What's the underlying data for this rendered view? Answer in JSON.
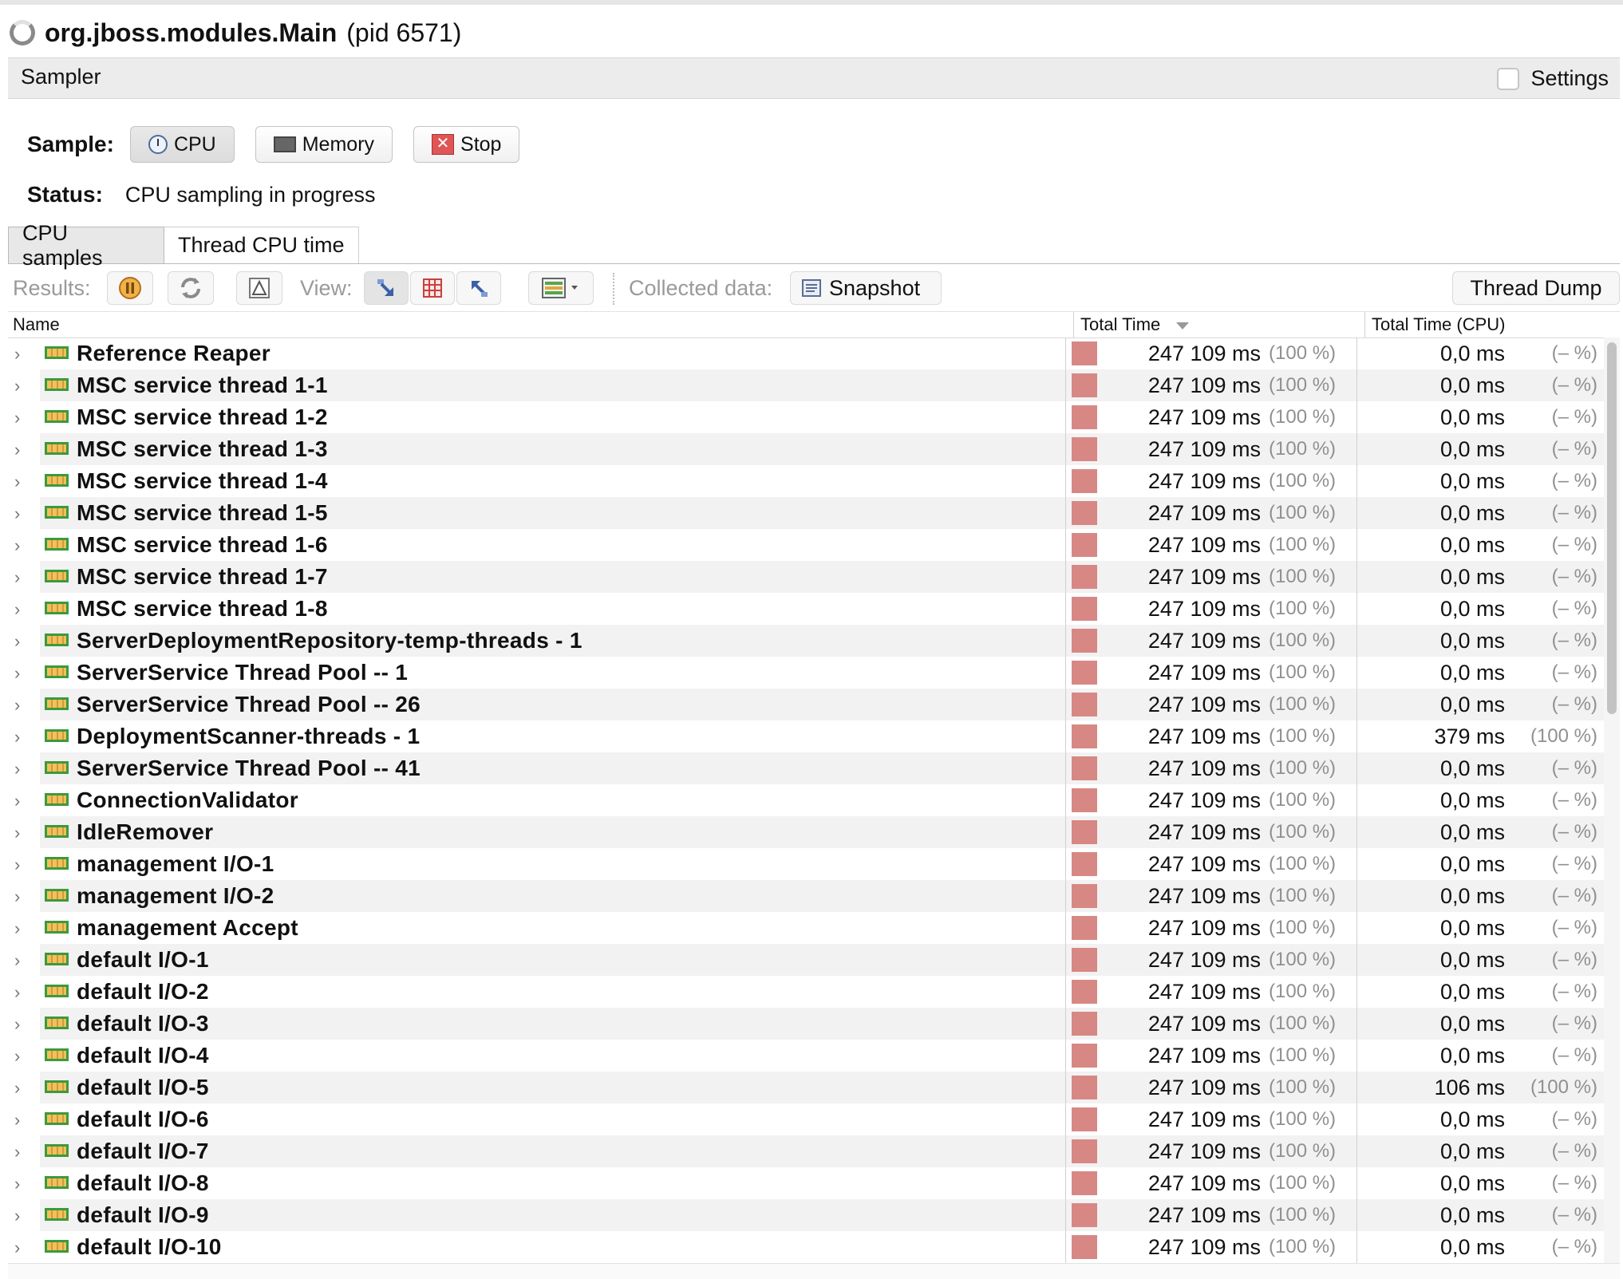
{
  "window": {
    "title": "org.jboss.modules.Main",
    "pid": "(pid 6571)"
  },
  "sampler": {
    "label": "Sampler",
    "settings_label": "Settings"
  },
  "sample": {
    "label": "Sample:",
    "cpu_label": "CPU",
    "memory_label": "Memory",
    "stop_label": "Stop",
    "status_label": "Status:",
    "status_value": "CPU sampling in progress"
  },
  "tabs": [
    {
      "label": "CPU samples",
      "active": true
    },
    {
      "label": "Thread CPU time",
      "active": false
    }
  ],
  "toolbar": {
    "results_label": "Results:",
    "view_label": "View:",
    "collected_label": "Collected data:",
    "snapshot_label": "Snapshot",
    "thread_dump_label": "Thread Dump"
  },
  "table": {
    "columns": {
      "name": "Name",
      "total_time": "Total Time",
      "total_time_cpu": "Total Time (CPU)"
    },
    "rows": [
      {
        "name": "Reference Reaper",
        "total": "247 109 ms",
        "total_pct": "(100 %)",
        "cpu": "0,0 ms",
        "cpu_pct": "(– %)"
      },
      {
        "name": "MSC service thread 1-1",
        "total": "247 109 ms",
        "total_pct": "(100 %)",
        "cpu": "0,0 ms",
        "cpu_pct": "(– %)"
      },
      {
        "name": "MSC service thread 1-2",
        "total": "247 109 ms",
        "total_pct": "(100 %)",
        "cpu": "0,0 ms",
        "cpu_pct": "(– %)"
      },
      {
        "name": "MSC service thread 1-3",
        "total": "247 109 ms",
        "total_pct": "(100 %)",
        "cpu": "0,0 ms",
        "cpu_pct": "(– %)"
      },
      {
        "name": "MSC service thread 1-4",
        "total": "247 109 ms",
        "total_pct": "(100 %)",
        "cpu": "0,0 ms",
        "cpu_pct": "(– %)"
      },
      {
        "name": "MSC service thread 1-5",
        "total": "247 109 ms",
        "total_pct": "(100 %)",
        "cpu": "0,0 ms",
        "cpu_pct": "(– %)"
      },
      {
        "name": "MSC service thread 1-6",
        "total": "247 109 ms",
        "total_pct": "(100 %)",
        "cpu": "0,0 ms",
        "cpu_pct": "(– %)"
      },
      {
        "name": "MSC service thread 1-7",
        "total": "247 109 ms",
        "total_pct": "(100 %)",
        "cpu": "0,0 ms",
        "cpu_pct": "(– %)"
      },
      {
        "name": "MSC service thread 1-8",
        "total": "247 109 ms",
        "total_pct": "(100 %)",
        "cpu": "0,0 ms",
        "cpu_pct": "(– %)"
      },
      {
        "name": "ServerDeploymentRepository-temp-threads - 1",
        "total": "247 109 ms",
        "total_pct": "(100 %)",
        "cpu": "0,0 ms",
        "cpu_pct": "(– %)"
      },
      {
        "name": "ServerService Thread Pool -- 1",
        "total": "247 109 ms",
        "total_pct": "(100 %)",
        "cpu": "0,0 ms",
        "cpu_pct": "(– %)"
      },
      {
        "name": "ServerService Thread Pool -- 26",
        "total": "247 109 ms",
        "total_pct": "(100 %)",
        "cpu": "0,0 ms",
        "cpu_pct": "(– %)"
      },
      {
        "name": "DeploymentScanner-threads - 1",
        "total": "247 109 ms",
        "total_pct": "(100 %)",
        "cpu": "379 ms",
        "cpu_pct": "(100 %)"
      },
      {
        "name": "ServerService Thread Pool -- 41",
        "total": "247 109 ms",
        "total_pct": "(100 %)",
        "cpu": "0,0 ms",
        "cpu_pct": "(– %)"
      },
      {
        "name": "ConnectionValidator",
        "total": "247 109 ms",
        "total_pct": "(100 %)",
        "cpu": "0,0 ms",
        "cpu_pct": "(– %)"
      },
      {
        "name": "IdleRemover",
        "total": "247 109 ms",
        "total_pct": "(100 %)",
        "cpu": "0,0 ms",
        "cpu_pct": "(– %)"
      },
      {
        "name": "management I/O-1",
        "total": "247 109 ms",
        "total_pct": "(100 %)",
        "cpu": "0,0 ms",
        "cpu_pct": "(– %)"
      },
      {
        "name": "management I/O-2",
        "total": "247 109 ms",
        "total_pct": "(100 %)",
        "cpu": "0,0 ms",
        "cpu_pct": "(– %)"
      },
      {
        "name": "management Accept",
        "total": "247 109 ms",
        "total_pct": "(100 %)",
        "cpu": "0,0 ms",
        "cpu_pct": "(– %)"
      },
      {
        "name": "default I/O-1",
        "total": "247 109 ms",
        "total_pct": "(100 %)",
        "cpu": "0,0 ms",
        "cpu_pct": "(– %)"
      },
      {
        "name": "default I/O-2",
        "total": "247 109 ms",
        "total_pct": "(100 %)",
        "cpu": "0,0 ms",
        "cpu_pct": "(– %)"
      },
      {
        "name": "default I/O-3",
        "total": "247 109 ms",
        "total_pct": "(100 %)",
        "cpu": "0,0 ms",
        "cpu_pct": "(– %)"
      },
      {
        "name": "default I/O-4",
        "total": "247 109 ms",
        "total_pct": "(100 %)",
        "cpu": "0,0 ms",
        "cpu_pct": "(– %)"
      },
      {
        "name": "default I/O-5",
        "total": "247 109 ms",
        "total_pct": "(100 %)",
        "cpu": "106 ms",
        "cpu_pct": "(100 %)"
      },
      {
        "name": "default I/O-6",
        "total": "247 109 ms",
        "total_pct": "(100 %)",
        "cpu": "0,0 ms",
        "cpu_pct": "(– %)"
      },
      {
        "name": "default I/O-7",
        "total": "247 109 ms",
        "total_pct": "(100 %)",
        "cpu": "0,0 ms",
        "cpu_pct": "(– %)"
      },
      {
        "name": "default I/O-8",
        "total": "247 109 ms",
        "total_pct": "(100 %)",
        "cpu": "0,0 ms",
        "cpu_pct": "(– %)"
      },
      {
        "name": "default I/O-9",
        "total": "247 109 ms",
        "total_pct": "(100 %)",
        "cpu": "0,0 ms",
        "cpu_pct": "(– %)"
      },
      {
        "name": "default I/O-10",
        "total": "247 109 ms",
        "total_pct": "(100 %)",
        "cpu": "0,0 ms",
        "cpu_pct": "(– %)"
      }
    ]
  },
  "colors": {
    "bar": "#d78885",
    "alt_row": "#f2f2f2",
    "muted": "#909090"
  },
  "icons": [
    "spinner-icon",
    "clock-icon",
    "memory-icon",
    "stop-icon",
    "pause-icon",
    "refresh-icon",
    "delta-icon",
    "forward-calls-icon",
    "hot-spots-icon",
    "reverse-calls-icon",
    "columns-icon",
    "snapshot-icon",
    "expand-chevron-icon",
    "thread-icon"
  ]
}
